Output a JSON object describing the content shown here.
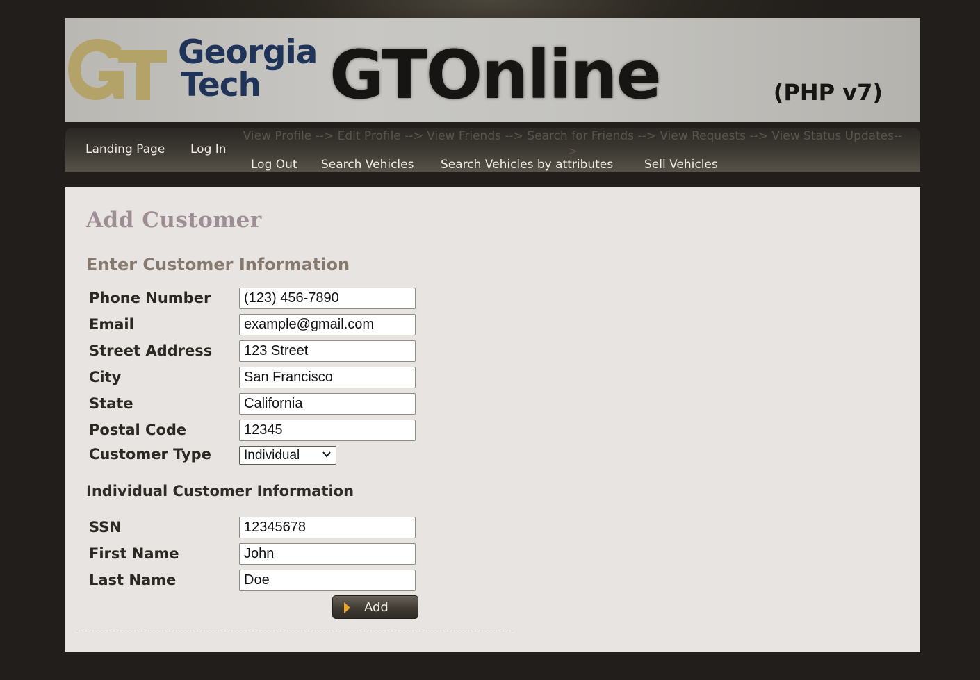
{
  "banner": {
    "org_line1": "Georgia",
    "org_line2": "Tech",
    "app_title": "GTOnline",
    "version": "(PHP v7)",
    "logo_icon": "gt-logo-icon",
    "logo_color": "#b3a369"
  },
  "nav": {
    "landing": "Landing Page",
    "login": "Log In",
    "faint_links": "View Profile --> Edit Profile --> View Friends --> Search for Friends --> View Requests --> View Status Updates-->",
    "logout": "Log Out",
    "search_vehicles": "Search Vehicles",
    "search_by_attributes": "Search Vehicles by attributes",
    "sell_vehicles": "Sell Vehicles"
  },
  "page": {
    "title": "Add Customer",
    "section_customer": "Enter Customer Information",
    "section_individual": "Individual Customer Information"
  },
  "form": {
    "phone": {
      "label": "Phone Number",
      "value": "(123) 456-7890"
    },
    "email": {
      "label": "Email",
      "value": "example@gmail.com"
    },
    "street": {
      "label": "Street Address",
      "value": "123 Street"
    },
    "city": {
      "label": "City",
      "value": "San Francisco"
    },
    "state": {
      "label": "State",
      "value": "California"
    },
    "postal": {
      "label": "Postal Code",
      "value": "12345"
    },
    "customer_type": {
      "label": "Customer Type",
      "value": "Individual"
    },
    "ssn": {
      "label": "SSN",
      "value": "12345678"
    },
    "first_name": {
      "label": "First Name",
      "value": "John"
    },
    "last_name": {
      "label": "Last Name",
      "value": "Doe"
    },
    "submit": "Add"
  },
  "colors": {
    "accent": "#e9a523",
    "navy": "#1f3458",
    "gold": "#b3a369"
  }
}
